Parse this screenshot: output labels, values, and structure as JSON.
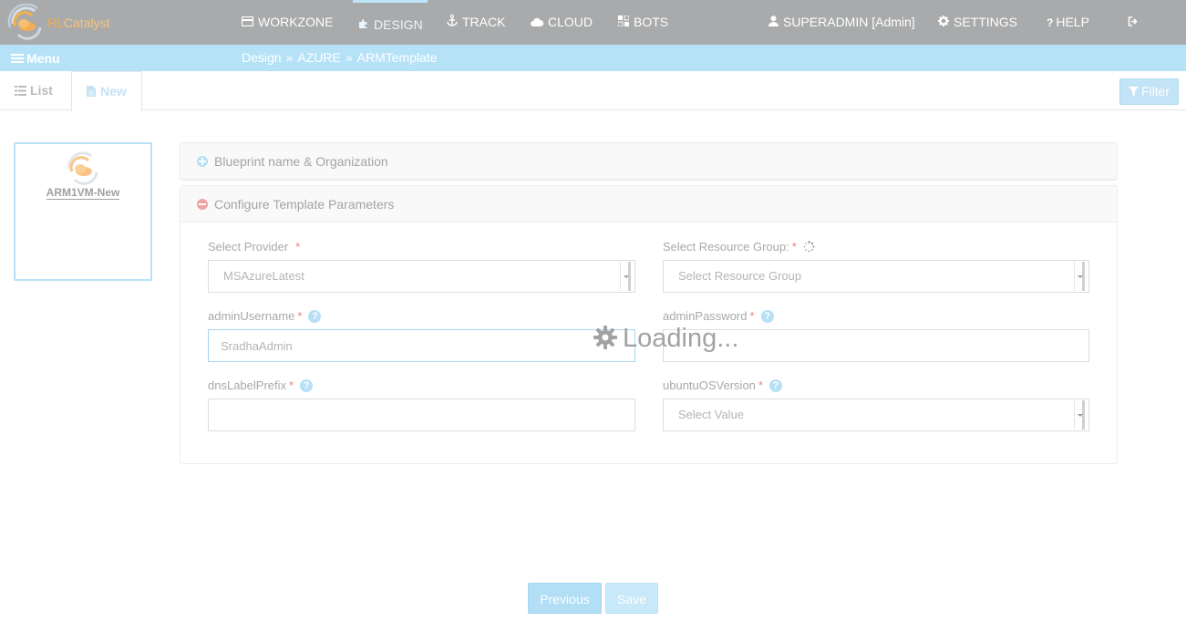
{
  "app": {
    "logo_text_prefix": "RL",
    "logo_text_suffix": "Catalyst"
  },
  "nav": {
    "items": [
      {
        "label": "WORKZONE",
        "icon": "card-icon"
      },
      {
        "label": "DESIGN",
        "icon": "puzzle-icon",
        "active": true
      },
      {
        "label": "TRACK",
        "icon": "anchor-icon"
      },
      {
        "label": "CLOUD",
        "icon": "cloud-icon"
      },
      {
        "label": "BOTS",
        "icon": "bots-icon"
      }
    ],
    "user": "SUPERADMIN [Admin]",
    "settings": "SETTINGS",
    "help": "HELP",
    "help_icon_glyph": "?",
    "logout_icon": "sign-out-icon"
  },
  "subbar": {
    "menu_label": "Menu",
    "breadcrumb": [
      "Design",
      "AZURE",
      "ARMTemplate"
    ],
    "separator": "»"
  },
  "tabs": {
    "list_label": "List",
    "new_label": "New",
    "filter_label": "Filter"
  },
  "blueprint_card": {
    "name": "ARM1VM-New"
  },
  "panels": {
    "blueprint_title": "Blueprint name & Organization",
    "template_title": "Configure Template Parameters"
  },
  "form": {
    "provider_label": "Select Provider",
    "provider_value": "MSAzureLatest",
    "resource_group_label": "Select Resource Group:",
    "resource_group_value": "Select Resource Group",
    "admin_username_label": "adminUsername",
    "admin_username_value": "SradhaAdmin",
    "admin_password_label": "adminPassword",
    "admin_password_value": "",
    "dns_label": "dnsLabelPrefix",
    "dns_value": "",
    "ubuntu_label": "ubuntuOSVersion",
    "ubuntu_value": "Select Value",
    "required_mark": "*",
    "help_glyph": "?"
  },
  "overlay": {
    "loading_text": "Loading..."
  },
  "buttons": {
    "previous": "Previous",
    "save": "Save"
  },
  "colors": {
    "topbar": "#a9aaab",
    "subbar": "#b6e2f8",
    "accent_light": "#c2e4f6",
    "required": "#e88080",
    "panel_plus": "#b7e0f7",
    "panel_minus": "#eea4a4"
  }
}
